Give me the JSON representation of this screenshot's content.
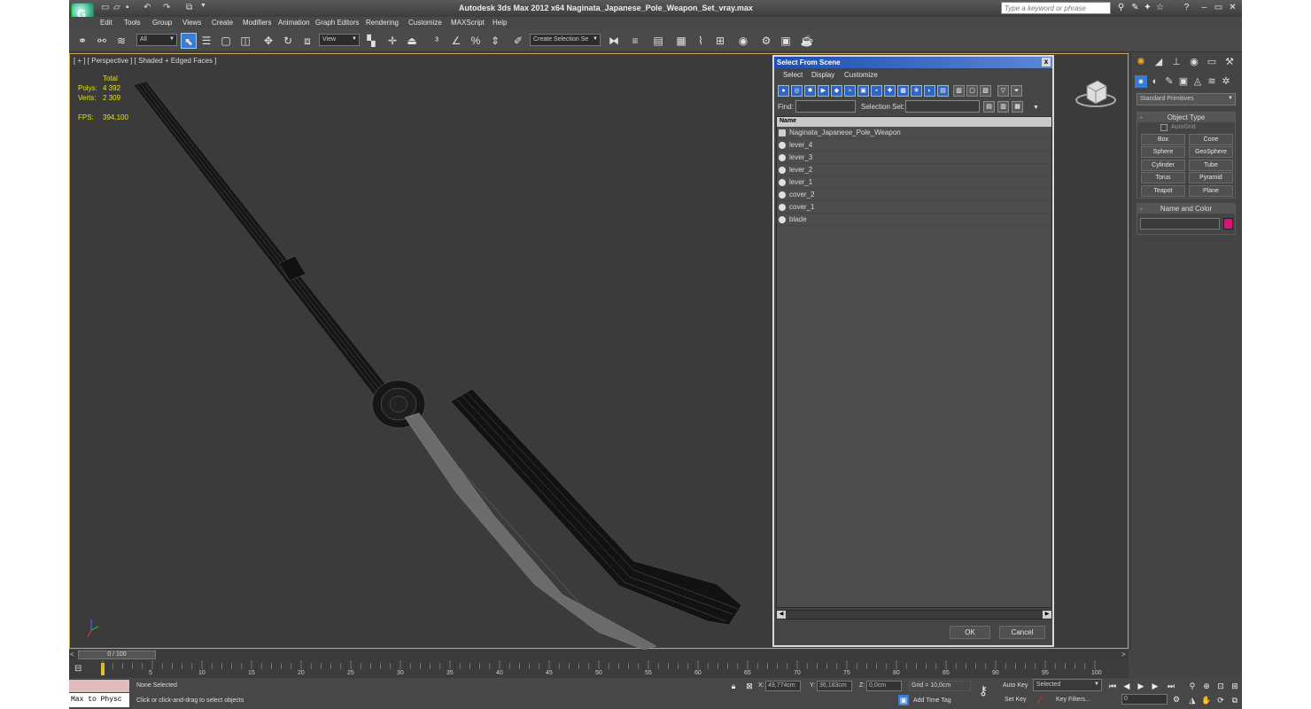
{
  "app": {
    "title": "Autodesk 3ds Max  2012 x64     Naginata_Japanese_Pole_Weapon_Set_vray.max",
    "logo_letter": "G",
    "search_placeholder": "Type a keyword or phrase"
  },
  "menu": [
    "Edit",
    "Tools",
    "Group",
    "Views",
    "Create",
    "Modifiers",
    "Animation",
    "Graph Editors",
    "Rendering",
    "Customize",
    "MAXScript",
    "Help"
  ],
  "toolbar": {
    "filter_value": "All",
    "coord_value": "View",
    "selection_set_placeholder": "Create Selection Se"
  },
  "viewport": {
    "label": "[ + ] [ Perspective ] [ Shaded + Edged Faces ]",
    "stats_header": "Total",
    "polys_label": "Polys:",
    "polys_value": "4 392",
    "verts_label": "Verts:",
    "verts_value": "2 309",
    "fps_label": "FPS:",
    "fps_value": "394,100",
    "colors": {
      "wire": "#141414",
      "blade": "#6e6e6e",
      "background": "#3b3b3b",
      "border": "#c8a45a"
    }
  },
  "dialog": {
    "title": "Select From Scene",
    "close": "x",
    "menu": [
      "Select",
      "Display",
      "Customize"
    ],
    "find_label": "Find:",
    "selection_set_label": "Selection Set:",
    "column_name": "Name",
    "items": [
      {
        "name": "Naginata_Japanese_Pole_Weapon"
      },
      {
        "name": "lever_4"
      },
      {
        "name": "lever_3"
      },
      {
        "name": "lever_2"
      },
      {
        "name": "lever_1"
      },
      {
        "name": "cover_2"
      },
      {
        "name": "cover_1"
      },
      {
        "name": "blade"
      }
    ],
    "ok": "OK",
    "cancel": "Cancel"
  },
  "command_panel": {
    "category": "Standard Primitives",
    "object_type_title": "Object Type",
    "autogrid": "AutoGrid",
    "buttons": [
      "Box",
      "Cone",
      "Sphere",
      "GeoSphere",
      "Cylinder",
      "Tube",
      "Torus",
      "Pyramid",
      "Teapot",
      "Plane"
    ],
    "name_color_title": "Name and Color",
    "swatch_color": "#d4157a"
  },
  "timeline": {
    "frame_display": "0 / 100",
    "ticks": [
      "0",
      "5",
      "10",
      "15",
      "20",
      "25",
      "30",
      "35",
      "40",
      "45",
      "50",
      "55",
      "60",
      "65",
      "70",
      "75",
      "80",
      "85",
      "90",
      "95",
      "100"
    ]
  },
  "status": {
    "maxscript": "Max to Physc",
    "selection": "None Selected",
    "prompt": "Click or click-and-drag to select objects",
    "x_label": "X:",
    "x_value": "49,774cm",
    "y_label": "Y:",
    "y_value": "36,183cm",
    "z_label": "Z:",
    "z_value": "0,0cm",
    "grid": "Grid = 10,0cm",
    "add_time_tag": "Add Time Tag",
    "auto_key": "Auto Key",
    "set_key": "Set Key",
    "selected": "Selected",
    "key_filters": "Key Filters...",
    "frame_field": "0"
  }
}
